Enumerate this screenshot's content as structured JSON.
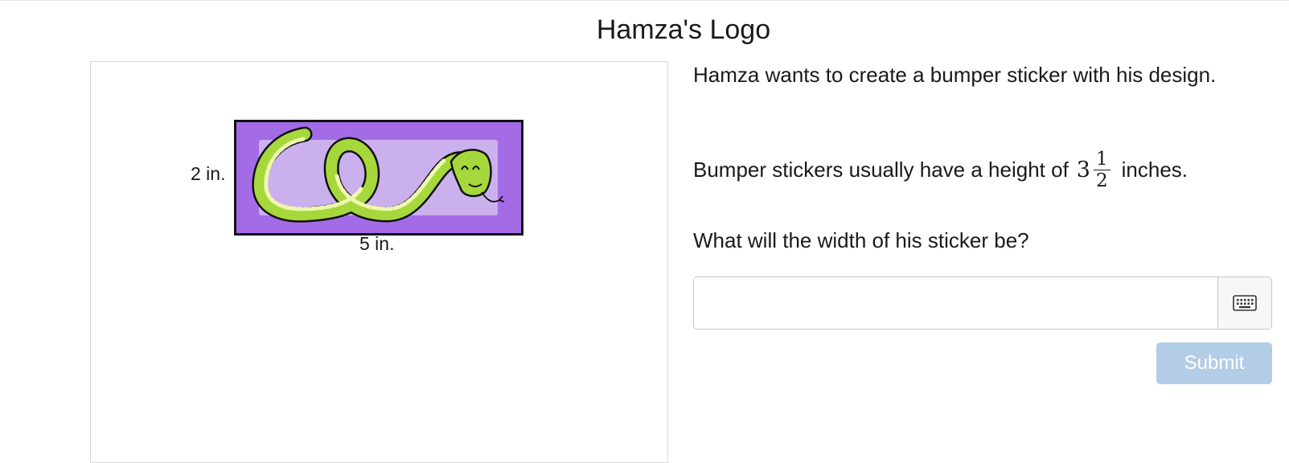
{
  "page": {
    "title": "Hamza's Logo"
  },
  "figure": {
    "height_label": "2 in.",
    "width_label": "5 in.",
    "sticker_image": "snake-logo",
    "colors": {
      "sticker_bg": "#a36ce6",
      "inner_panel": "#cbb0ee",
      "snake_body": "#a6d83c",
      "snake_belly": "#eef6b0",
      "outline": "#111111"
    }
  },
  "question": {
    "paragraph1": "Hamza wants to create a bumper sticker with his design.",
    "paragraph2_before": "Bumper stickers usually have a height of",
    "mixed_number": {
      "whole": "3",
      "numerator": "1",
      "denominator": "2"
    },
    "paragraph2_after": "inches.",
    "paragraph3": "What will the width of his sticker be?"
  },
  "answer": {
    "value": "",
    "placeholder": "",
    "keyboard_icon": "keyboard-icon"
  },
  "actions": {
    "submit_label": "Submit",
    "submit_color": "#b3cde6"
  }
}
